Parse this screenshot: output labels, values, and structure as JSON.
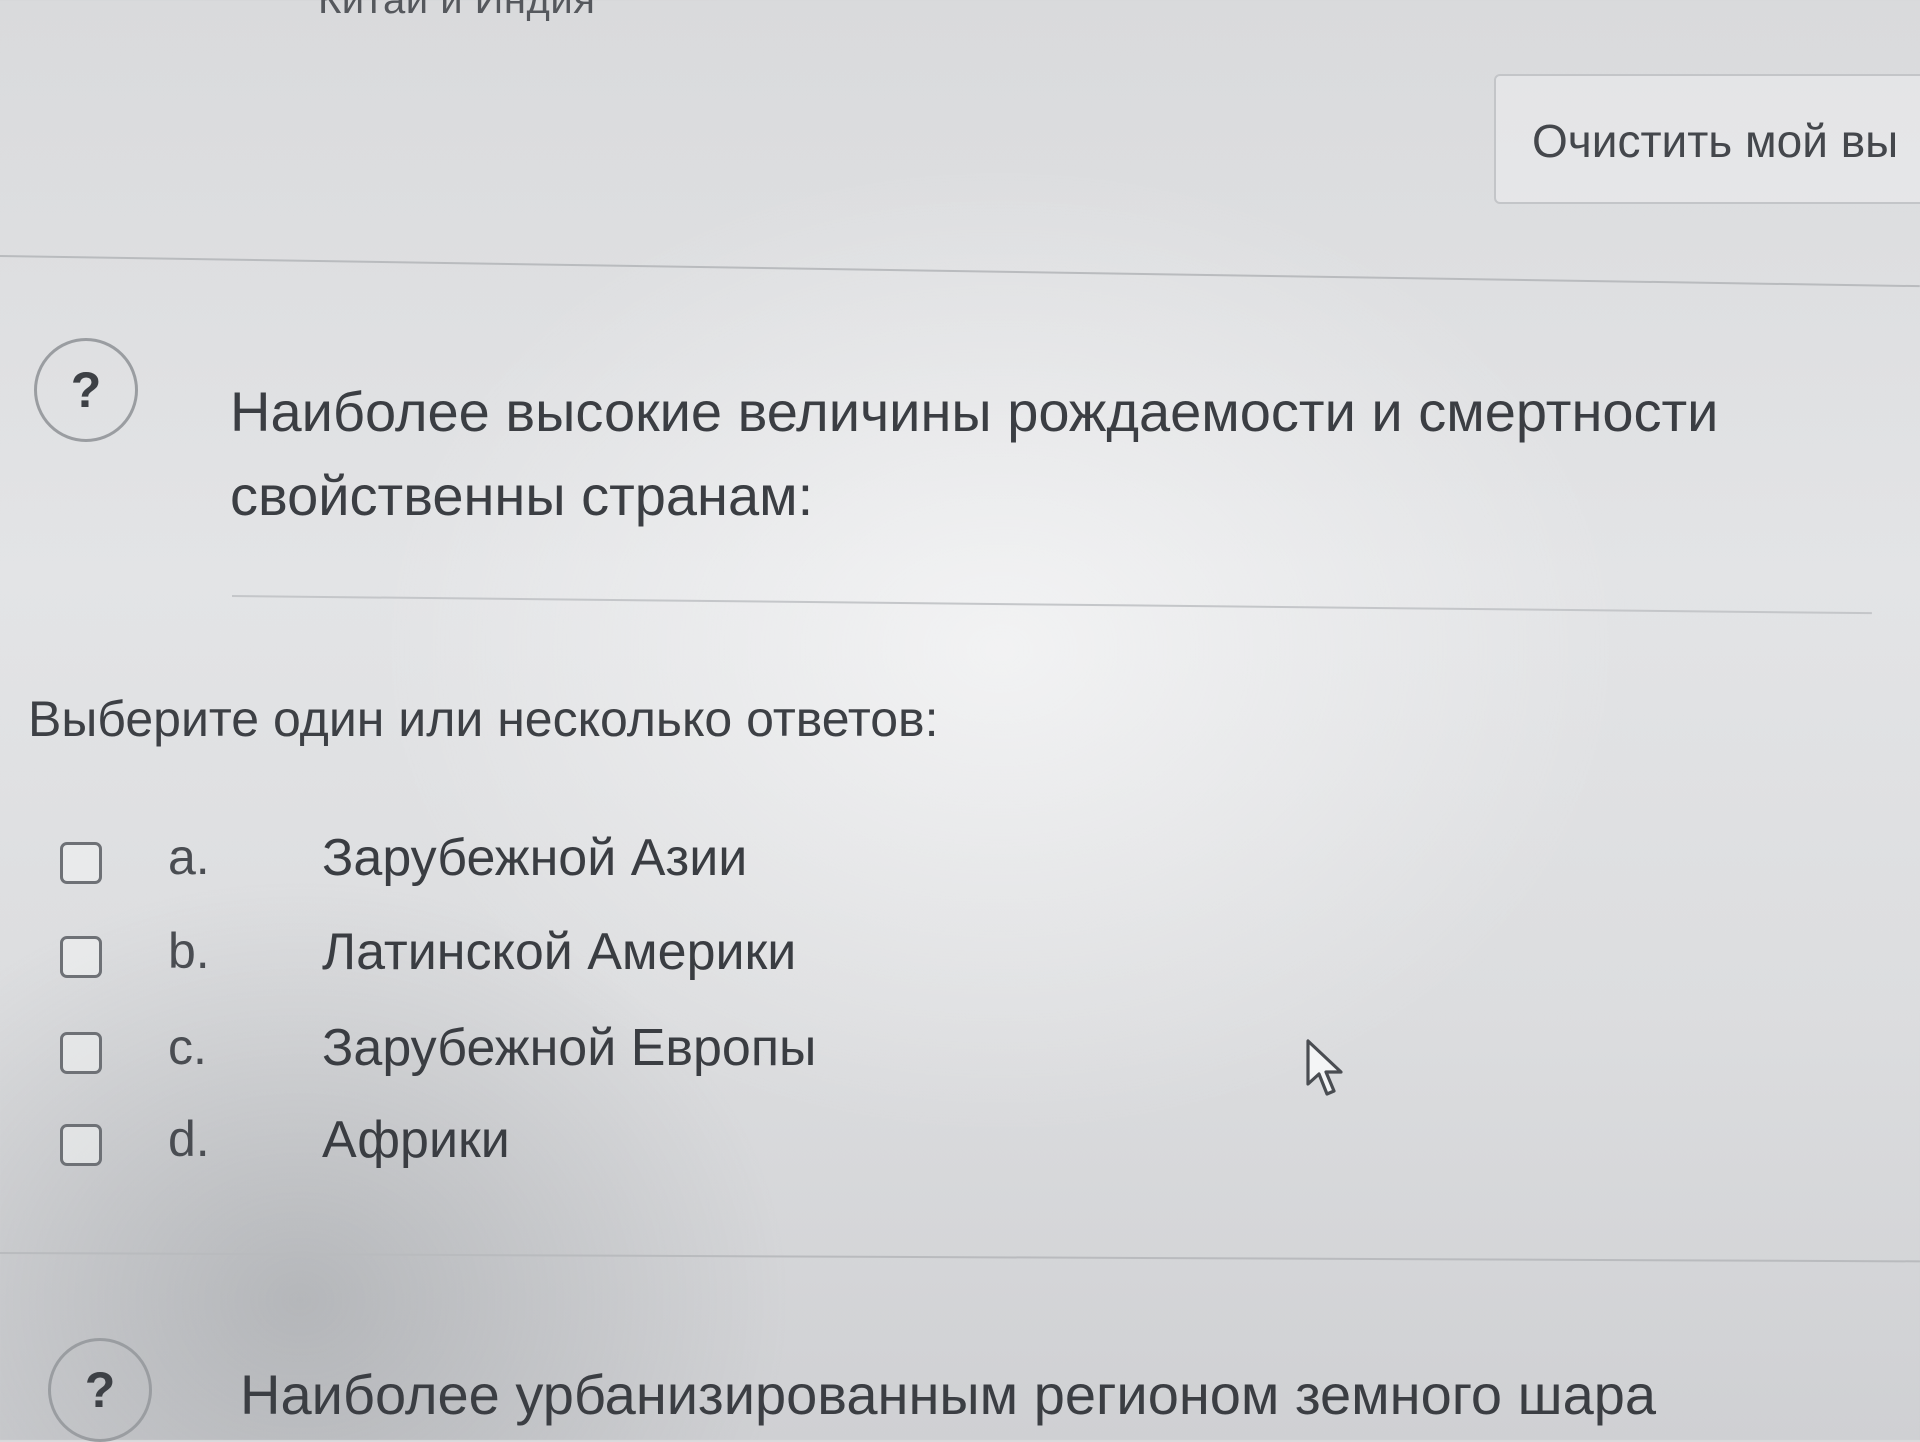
{
  "previous_question": {
    "selected_answer_text": "Китай и Индия",
    "clear_button_label": "Очистить мой вы"
  },
  "question": {
    "badge_icon": "?",
    "text": "Наиболее высокие величины рождаемости и смертности свойственны странам:",
    "instruction": "Выберите один или несколько ответов:",
    "options": [
      {
        "letter": "a.",
        "label": "Зарубежной Азии",
        "checked": false
      },
      {
        "letter": "b.",
        "label": "Латинской Америки",
        "checked": false
      },
      {
        "letter": "c.",
        "label": "Зарубежной Европы",
        "checked": false
      },
      {
        "letter": "d.",
        "label": "Африки",
        "checked": false
      }
    ]
  },
  "next_question": {
    "badge_icon": "?",
    "text": "Наиболее урбанизированным регионом земного шара"
  }
}
